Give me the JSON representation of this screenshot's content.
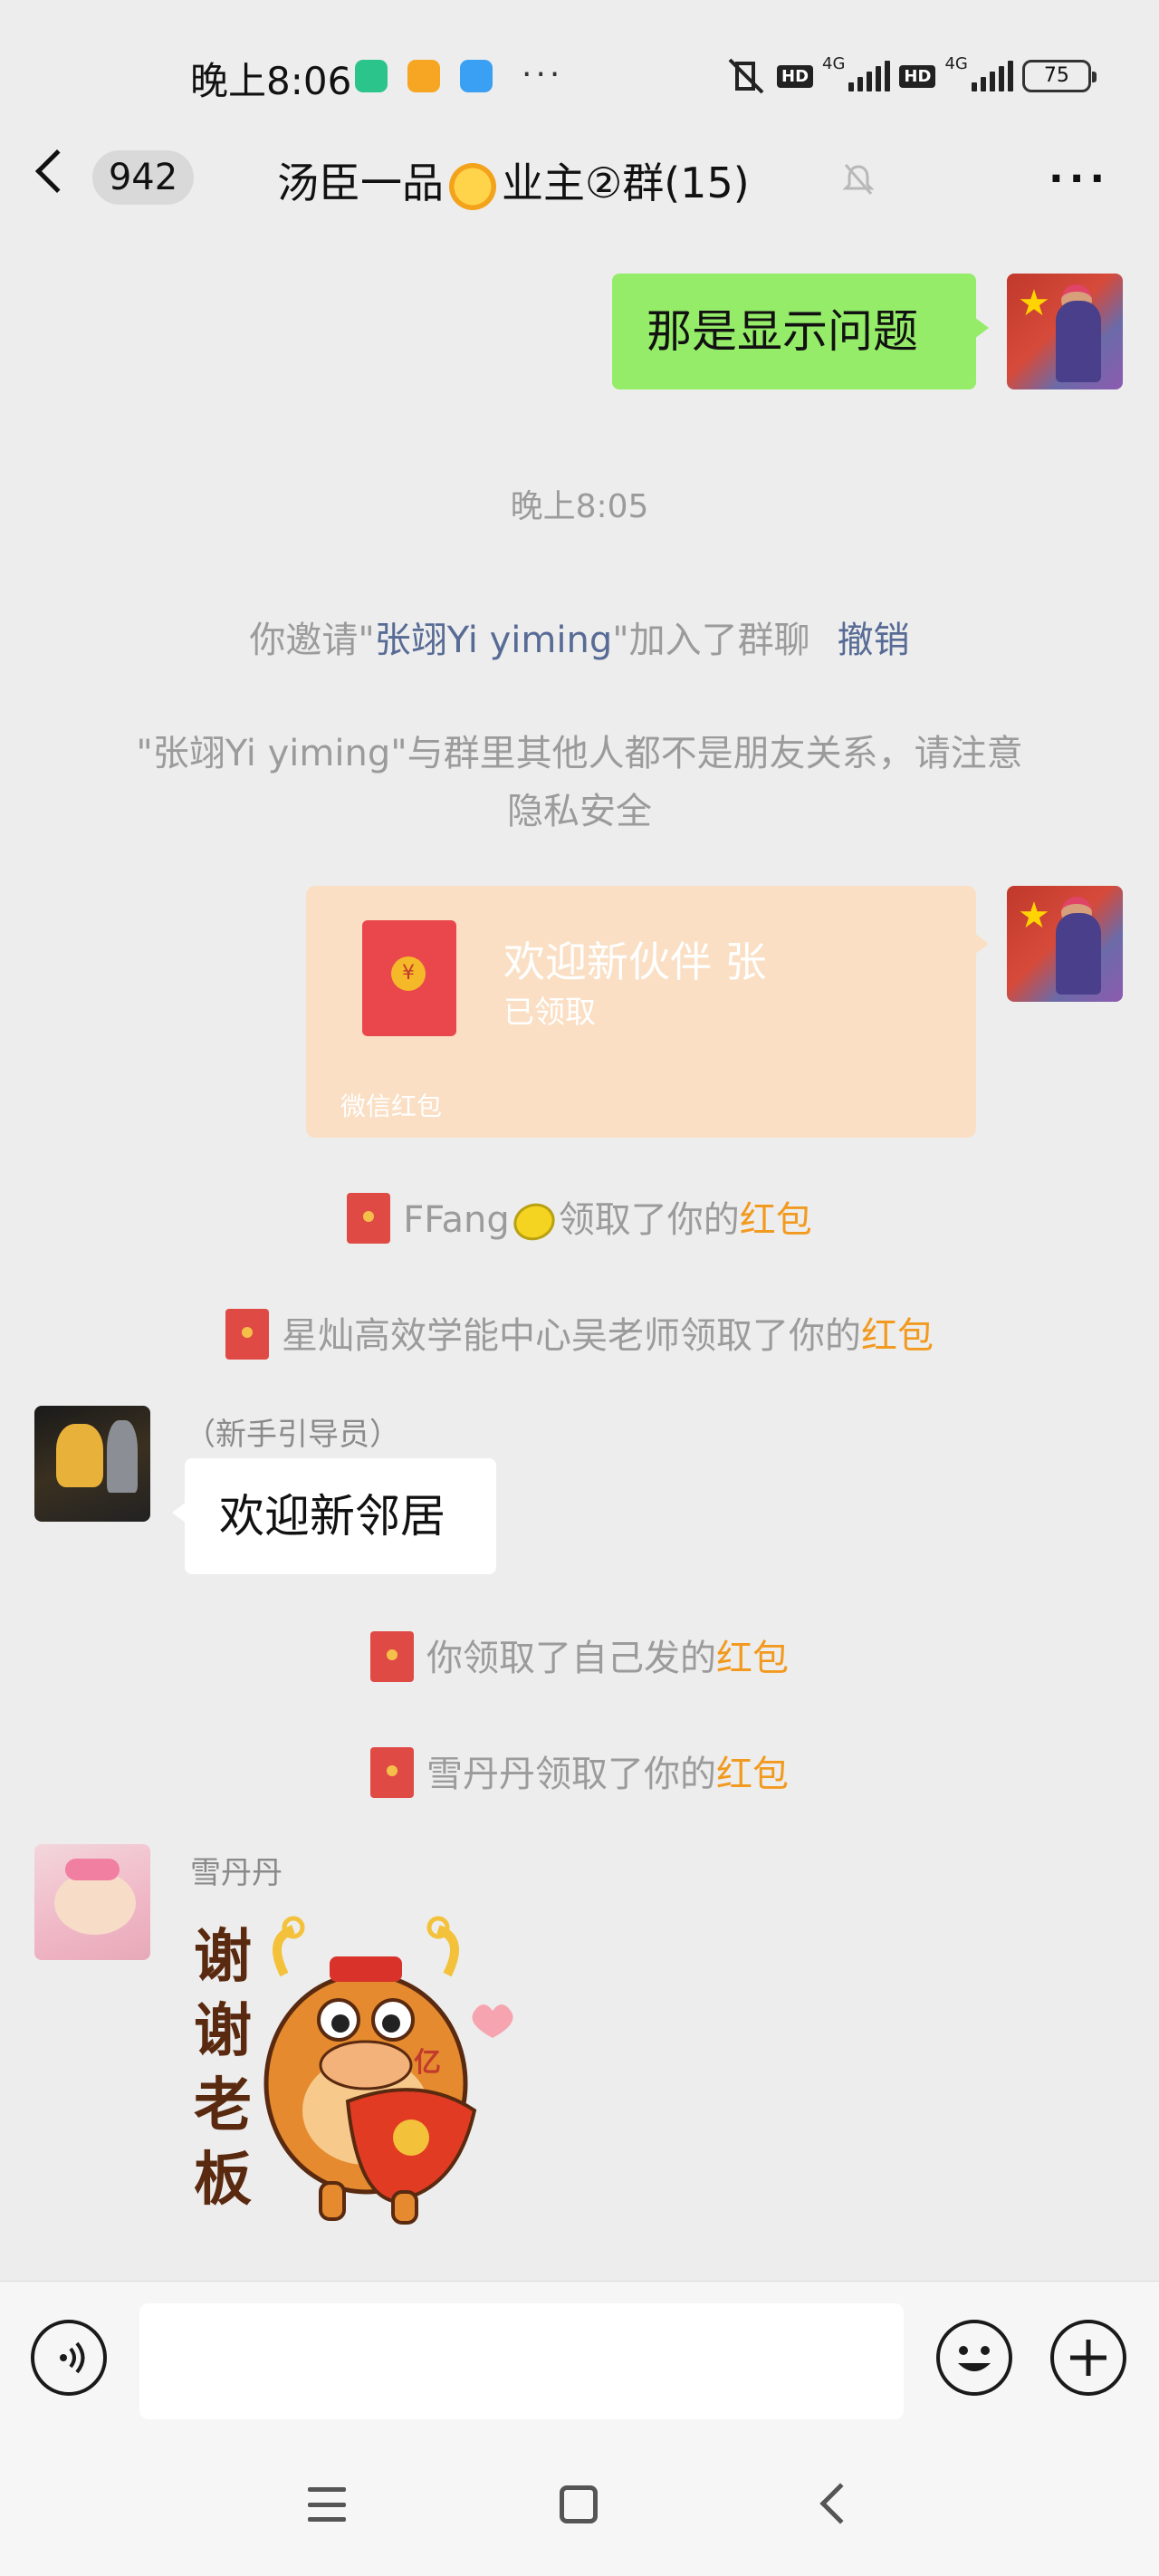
{
  "status_bar": {
    "time": "晚上8:06",
    "more": "···",
    "network_1": "4G",
    "network_2": "4G",
    "hd": "HD",
    "battery": "75",
    "app_icon_colors": [
      "#2bc48a",
      "#f6a623",
      "#3aa0f3"
    ]
  },
  "header": {
    "back_icon": "chevron-left-icon",
    "unread_count": "942",
    "title_prefix": "汤臣一品",
    "title_suffix": "业主②群(15)",
    "mute_icon": "bell-off-icon",
    "more_icon": "more-dots-icon"
  },
  "messages": {
    "m1_text": "那是显示问题",
    "timestamp": "晚上8:05",
    "invite_prefix": "你邀请\"",
    "invite_name": "张翊Yi yiming",
    "invite_suffix": "\"加入了群聊",
    "invite_undo": "撤销",
    "privacy_line1": "\"张翊Yi yiming\"与群里其他人都不是朋友关系，请注意",
    "privacy_line2": "隐私安全",
    "redpacket_title": "欢迎新伙伴  张",
    "redpacket_status": "已领取",
    "redpacket_label": "微信红包",
    "redpacket_coin": "¥",
    "claim1_name": "FFang",
    "claim1_text": "领取了你的",
    "claim2_text": "星灿高效学能中心吴老师领取了你的",
    "redpacket_word": "红包",
    "guide_name": "（新手引导员）",
    "guide_msg": "欢迎新邻居",
    "claim3_text": "你领取了自己发的",
    "claim4_text": "雪丹丹领取了你的",
    "xue_name": "雪丹丹",
    "sticker_text": [
      "谢",
      "谢",
      "老",
      "板"
    ],
    "sticker_coin": "亿"
  },
  "input_bar": {
    "voice_icon": "voice-icon",
    "emoji_icon": "emoji-icon",
    "plus_icon": "plus-icon",
    "placeholder": ""
  },
  "colors": {
    "bg": "#ededed",
    "my_bubble": "#95ec69",
    "redpacket": "#fadfc4",
    "link_blue": "#576b95",
    "redpacket_orange": "#f29a1f"
  }
}
